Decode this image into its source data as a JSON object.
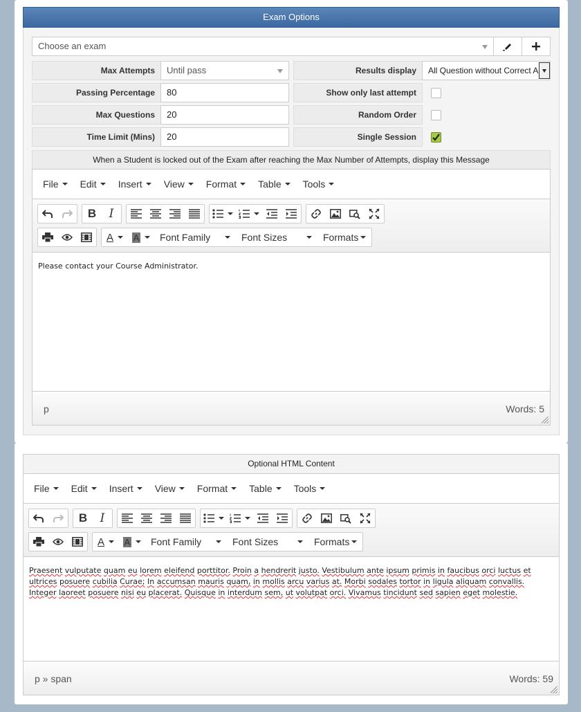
{
  "exam_options": {
    "header": "Exam Options",
    "exam_select": {
      "value": "Choose an exam"
    },
    "edit_icon": "pencil-icon",
    "add_icon": "plus-icon",
    "fields": {
      "max_attempts": {
        "label": "Max Attempts",
        "value": "Until pass"
      },
      "passing_percentage": {
        "label": "Passing Percentage",
        "value": "80"
      },
      "max_questions": {
        "label": "Max Questions",
        "value": "20"
      },
      "time_limit": {
        "label": "Time Limit (Mins)",
        "value": "20"
      },
      "results_display": {
        "label": "Results display",
        "value": "All Question without Correct Answers"
      },
      "show_only_last_attempt": {
        "label": "Show only last attempt",
        "checked": false
      },
      "random_order": {
        "label": "Random Order",
        "checked": false
      },
      "single_session": {
        "label": "Single Session",
        "checked": true
      }
    },
    "lockout_message_label": "When a Student is locked out of the Exam after reaching the Max Number of Attempts, display this Message"
  },
  "editor_menu": [
    "File",
    "Edit",
    "Insert",
    "View",
    "Format",
    "Table",
    "Tools"
  ],
  "editor_toolbar": {
    "font_family": "Font Family",
    "font_sizes": "Font Sizes",
    "formats": "Formats",
    "text_color_glyph": "A",
    "bg_color_glyph": "A",
    "bold_glyph": "B",
    "italic_glyph": "I"
  },
  "lockout_editor": {
    "content": "Please contact your Course Administrator.",
    "status_path": "p",
    "word_count": "Words: 5"
  },
  "optional_html": {
    "header": "Optional HTML Content",
    "content_words": [
      "Praesent",
      "vulputate",
      "quam",
      "eu",
      "lorem",
      "eleifend",
      "porttitor.",
      "Proin",
      "a",
      "hendrerit",
      "justo.",
      "Vestibulum",
      "ante",
      "ipsum",
      "primis",
      "in",
      "faucibus",
      "orci",
      "luctus",
      "et",
      "ultrices",
      "posuere",
      "cubilia",
      "Curae;",
      "In",
      "accumsan",
      "mauris",
      "quam,",
      "in",
      "mollis",
      "arcu",
      "varius",
      "at.",
      "Morbi",
      "sodales",
      "tortor",
      "in",
      "ligula",
      "aliquam",
      "convallis.",
      "Integer",
      "laoreet",
      "posuere",
      "nisi",
      "eu",
      "placerat.",
      "Quisque",
      "in",
      "interdum",
      "sem,",
      "ut",
      "volutpat",
      "orci.",
      "Vivamus",
      "tincidunt",
      "sed",
      "sapien",
      "eget",
      "molestie."
    ],
    "status_path": "p » span",
    "word_count": "Words: 59"
  },
  "colors": {
    "page_bg": "#a7b8c9",
    "header_blue": "#3b68a0",
    "checkbox_green": "#a6c84a"
  }
}
